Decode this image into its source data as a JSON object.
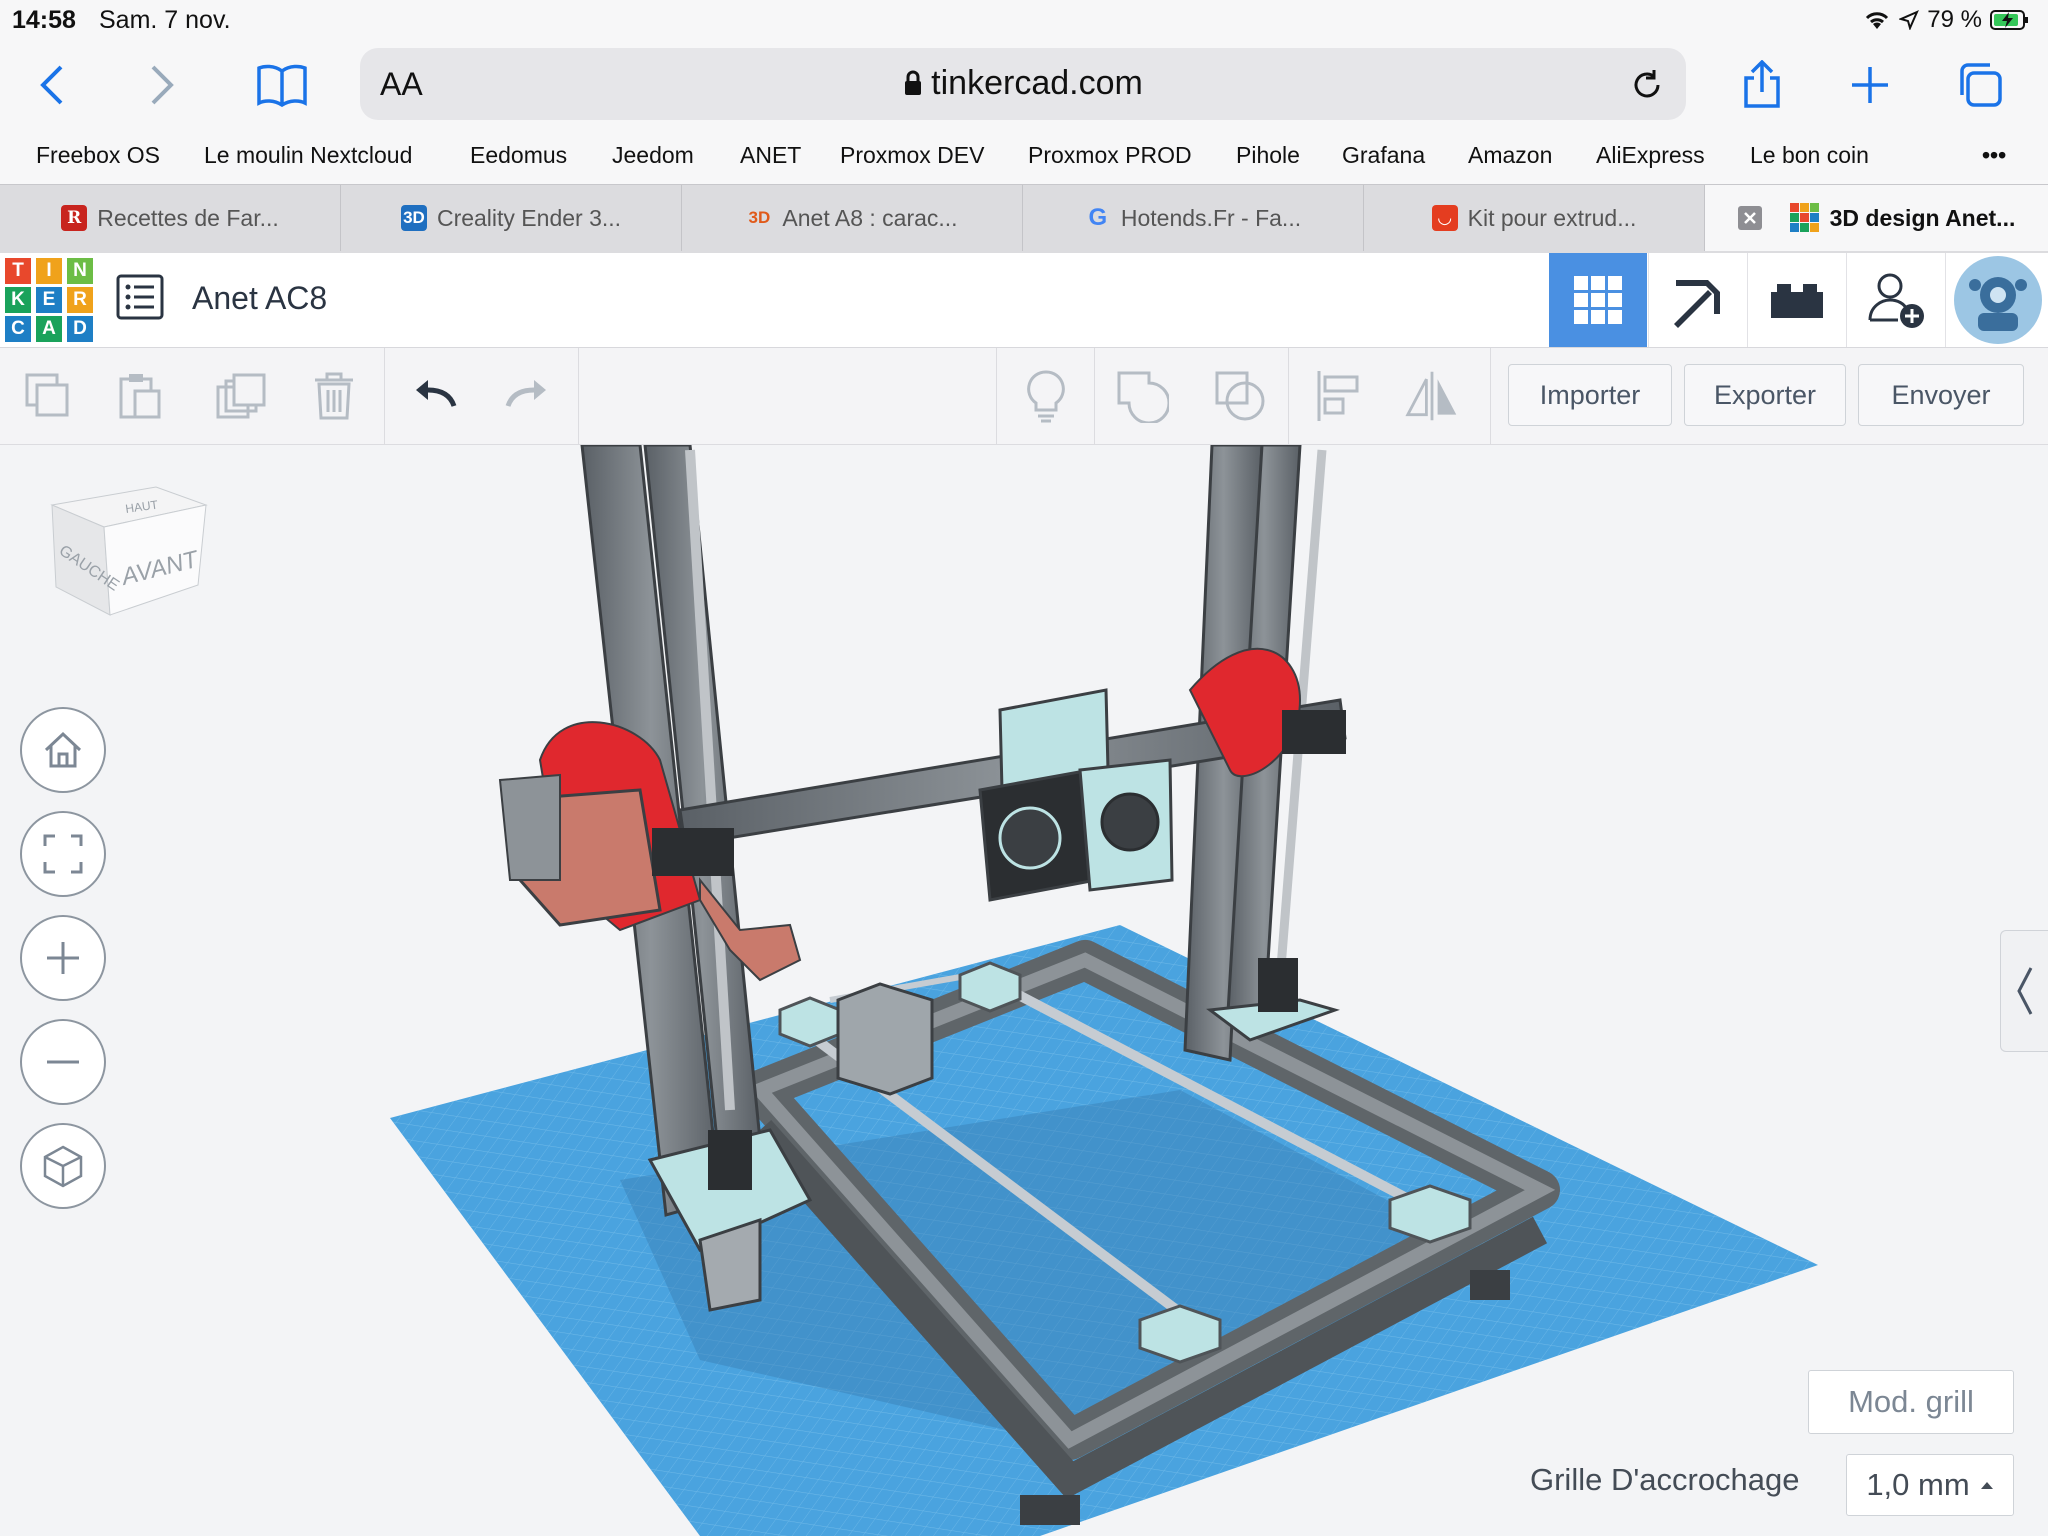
{
  "status": {
    "time": "14:58",
    "date": "Sam. 7 nov.",
    "battery": "79 %"
  },
  "browser": {
    "text_size": "AA",
    "url": "tinkercad.com",
    "bookmarks": [
      "Freebox OS",
      "Le moulin Nextcloud",
      "Eedomus",
      "Jeedom",
      "ANET",
      "Proxmox DEV",
      "Proxmox PROD",
      "Pihole",
      "Grafana",
      "Amazon",
      "AliExpress",
      "Le bon coin"
    ],
    "more": "•••",
    "tabs": [
      {
        "label": "Recettes de Far...",
        "icon": "R",
        "color": "#c8241e"
      },
      {
        "label": "Creality Ender 3...",
        "icon": "3D",
        "color": "#1f6fc0"
      },
      {
        "label": "Anet A8 : carac...",
        "icon": "3D",
        "color": "#e05a1a"
      },
      {
        "label": "Hotends.Fr - Fa...",
        "icon": "G",
        "color": "#4285f4"
      },
      {
        "label": "Kit pour extrud...",
        "icon": "◡",
        "color": "#e43d20"
      },
      {
        "label": "3D design Anet...",
        "icon": "TC",
        "color": "#1e7fc5"
      }
    ]
  },
  "tinkercad": {
    "logo": [
      "T",
      "I",
      "N",
      "K",
      "E",
      "R",
      "C",
      "A",
      "D"
    ],
    "document_name": "Anet AC8",
    "toolbar": {
      "import": "Importer",
      "export": "Exporter",
      "send": "Envoyer"
    },
    "viewcube": {
      "top": "HAUT",
      "left": "GAUCHE",
      "front": "AVANT"
    },
    "grid": {
      "edit_grid": "Mod. grill",
      "snap_label": "Grille D'accrochage",
      "snap_value": "1,0 mm"
    }
  },
  "colors": {
    "accent": "#4a90e2",
    "workplane": "#4aa3df",
    "frame": "#6f7478",
    "red_part": "#e0282e"
  }
}
